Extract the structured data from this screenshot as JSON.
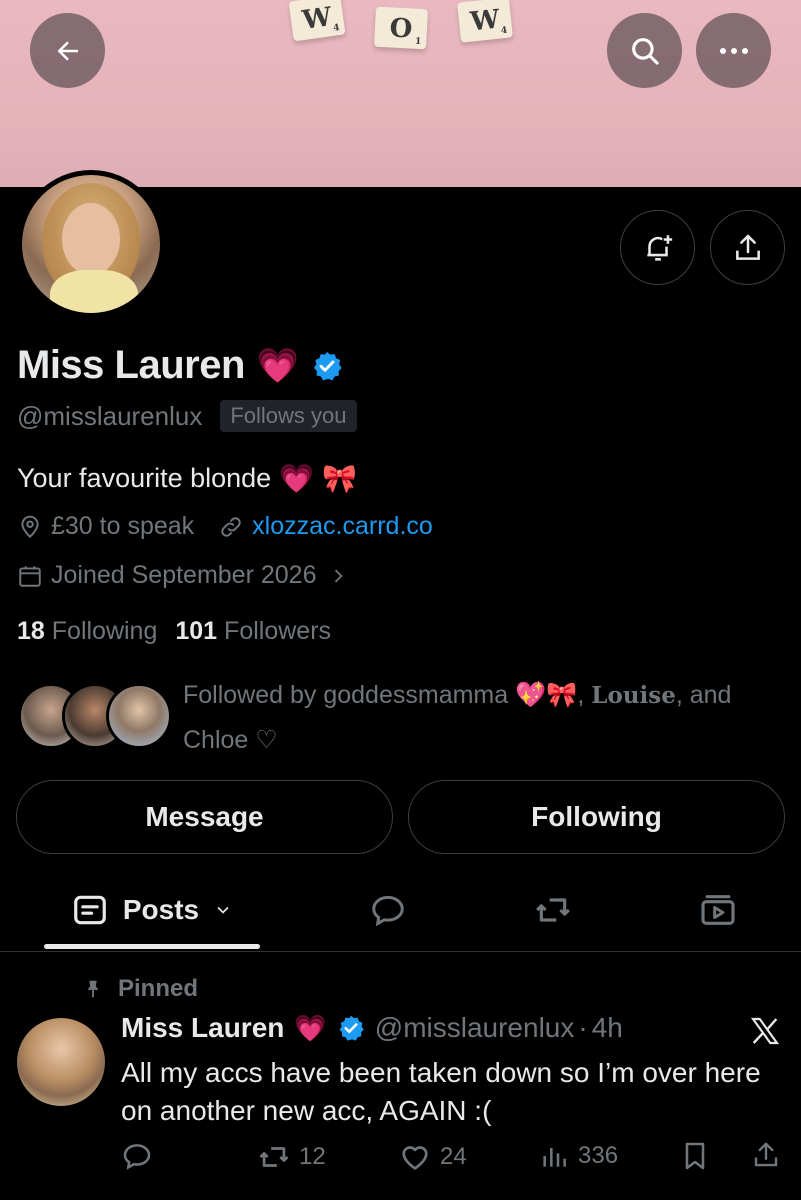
{
  "banner": {
    "tiles": [
      {
        "letter": "W",
        "score": "4"
      },
      {
        "letter": "O",
        "score": "1"
      },
      {
        "letter": "W",
        "score": "4"
      }
    ]
  },
  "profile": {
    "name": "Miss Lauren",
    "name_emoji": "💗",
    "handle": "@misslaurenlux",
    "follows_you": "Follows you",
    "bio": "Your favourite blonde",
    "bio_emoji": [
      "💗",
      "🎀"
    ],
    "location": "£30 to speak",
    "website": "xlozzac.carrd.co",
    "joined": "Joined September 2026",
    "following_count": "18",
    "following_label": "Following",
    "followers_count": "101",
    "followers_label": "Followers",
    "followed_by_prefix": "Followed by goddessmamma",
    "followed_by_emoji": "💖🎀",
    "followed_by_name2": "Louise",
    "followed_by_and": ", and",
    "followed_by_name3": "Chloe ♡"
  },
  "buttons": {
    "message": "Message",
    "following": "Following"
  },
  "tabs": {
    "posts": "Posts"
  },
  "tweet": {
    "pinned_label": "Pinned",
    "author": "Miss Lauren",
    "author_emoji": "💗",
    "handle": "@misslaurenlux",
    "separator": "·",
    "time": "4h",
    "text": "All my accs have been taken down so I’m over here on another new acc, AGAIN :(",
    "retweets": "12",
    "likes": "24",
    "views": "336"
  },
  "colors": {
    "background": "#000000",
    "text": "#e7e9ea",
    "muted": "#71767b",
    "link": "#1d9bf0",
    "verified": "#1d9bf0",
    "banner": "#e6b3bb"
  }
}
